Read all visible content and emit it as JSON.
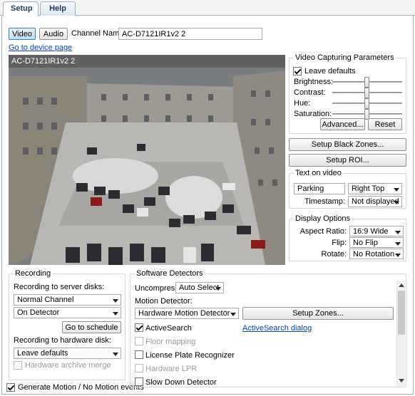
{
  "tabs": [
    {
      "label": "Setup",
      "active": true
    },
    {
      "label": "Help",
      "active": false
    }
  ],
  "top": {
    "video_btn": "Video",
    "audio_btn": "Audio",
    "channel_name_label": "Channel Name:",
    "channel_name_value": "AC-D7121IR1v2 2",
    "device_link": "Go to device page"
  },
  "video": {
    "overlay_title": "AC-D7121IR1v2 2"
  },
  "capture": {
    "title": "Video Capturing Parameters",
    "leave_defaults": "Leave defaults",
    "leave_defaults_checked": true,
    "sliders": [
      {
        "label": "Brightness:",
        "value": 0.5
      },
      {
        "label": "Contrast:",
        "value": 0.5
      },
      {
        "label": "Hue:",
        "value": 0.5
      },
      {
        "label": "Saturation:",
        "value": 0.5
      }
    ],
    "advanced_btn": "Advanced...",
    "reset_btn": "Reset"
  },
  "setup_black_zones_btn": "Setup Black Zones...",
  "setup_roi_btn": "Setup ROI...",
  "text_on_video": {
    "title": "Text on video",
    "text_value": "Parking",
    "position": "Right Top",
    "timestamp_label": "Timestamp:",
    "timestamp_value": "Not displayed"
  },
  "display": {
    "title": "Display Options",
    "aspect_label": "Aspect Ratio:",
    "aspect_value": "16:9 Wide",
    "flip_label": "Flip:",
    "flip_value": "No Flip",
    "rotate_label": "Rotate:",
    "rotate_value": "No Rotation"
  },
  "recording": {
    "title": "Recording",
    "server_label": "Recording to server disks:",
    "channel_mode": "Normal Channel",
    "trigger": "On Detector",
    "schedule_btn": "Go to schedule",
    "hw_label": "Recording to hardware disk:",
    "hw_value": "Leave defaults",
    "hw_merge": "Hardware archive merge"
  },
  "generate_events": {
    "label": "Generate Motion / No Motion events",
    "checked": true
  },
  "detectors": {
    "title": "Software Detectors",
    "uncompress_label": "Uncompress:",
    "uncompress_value": "Auto Select",
    "motion_label": "Motion Detector:",
    "motion_value": "Hardware Motion Detector",
    "setup_zones_btn": "Setup Zones...",
    "items": [
      {
        "label": "ActiveSearch",
        "checked": true,
        "disabled": false
      },
      {
        "label": "Floor mapping",
        "checked": false,
        "disabled": true
      },
      {
        "label": "License Plate Recognizer",
        "checked": false,
        "disabled": false
      },
      {
        "label": "Hardware LPR",
        "checked": false,
        "disabled": true
      },
      {
        "label": "Slow Down Detector",
        "checked": false,
        "disabled": false
      }
    ],
    "activesearch_link": "ActiveSearch dialog"
  }
}
